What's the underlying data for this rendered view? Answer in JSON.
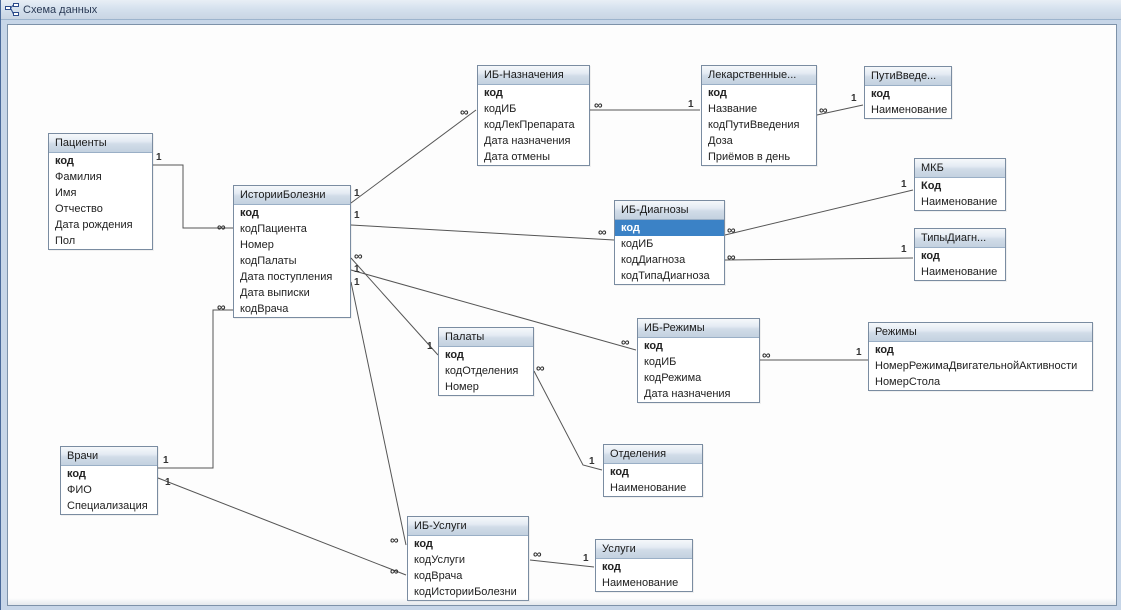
{
  "window": {
    "title": "Схема данных",
    "icon": "relationships-icon"
  },
  "labels": {
    "one": "1",
    "many": "∞"
  },
  "tables": {
    "patients": {
      "title": "Пациенты",
      "fields": [
        "код",
        "Фамилия",
        "Имя",
        "Отчество",
        "Дата рождения",
        "Пол"
      ],
      "pk": [
        0
      ]
    },
    "history": {
      "title": "ИсторииБолезни",
      "fields": [
        "код",
        "кодПациента",
        "Номер",
        "кодПалаты",
        "Дата поступления",
        "Дата выписки",
        "кодВрача"
      ],
      "pk": [
        0
      ]
    },
    "ib_nazn": {
      "title": "ИБ-Назначения",
      "fields": [
        "код",
        "кодИБ",
        "кодЛекПрепарата",
        "Дата назначения",
        "Дата отмены"
      ],
      "pk": [
        0
      ]
    },
    "lek": {
      "title": "Лекарственные...",
      "fields": [
        "код",
        "Название",
        "кодПутиВведения",
        "Доза",
        "Приёмов в день"
      ],
      "pk": [
        0
      ]
    },
    "puti": {
      "title": "ПутиВведе...",
      "fields": [
        "код",
        "Наименование"
      ],
      "pk": [
        0
      ]
    },
    "ib_diag": {
      "title": "ИБ-Диагнозы",
      "fields": [
        "код",
        "кодИБ",
        "кодДиагноза",
        "кодТипаДиагноза"
      ],
      "pk": [
        0
      ],
      "selected": 0
    },
    "mkb": {
      "title": "МКБ",
      "fields": [
        "Код",
        "Наименование"
      ],
      "pk": [
        0
      ]
    },
    "tipy_diag": {
      "title": "ТипыДиагн...",
      "fields": [
        "код",
        "Наименование"
      ],
      "pk": [
        0
      ]
    },
    "palaty": {
      "title": "Палаты",
      "fields": [
        "код",
        "кодОтделения",
        "Номер"
      ],
      "pk": [
        0
      ]
    },
    "ib_rezh": {
      "title": "ИБ-Режимы",
      "fields": [
        "код",
        "кодИБ",
        "кодРежима",
        "Дата назначения"
      ],
      "pk": [
        0
      ]
    },
    "rezhimy": {
      "title": "Режимы",
      "fields": [
        "код",
        "НомерРежимаДвигательнойАктивности",
        "НомерСтола"
      ],
      "pk": [
        0
      ]
    },
    "otdel": {
      "title": "Отделения",
      "fields": [
        "код",
        "Наименование"
      ],
      "pk": [
        0
      ]
    },
    "vrachi": {
      "title": "Врачи",
      "fields": [
        "код",
        "ФИО",
        "Специализация"
      ],
      "pk": [
        0
      ]
    },
    "ib_uslugi": {
      "title": "ИБ-Услуги",
      "fields": [
        "код",
        "кодУслуги",
        "кодВрача",
        "кодИсторииБолезни"
      ],
      "pk": [
        0
      ]
    },
    "uslugi": {
      "title": "Услуги",
      "fields": [
        "код",
        "Наименование"
      ],
      "pk": [
        0
      ]
    }
  }
}
